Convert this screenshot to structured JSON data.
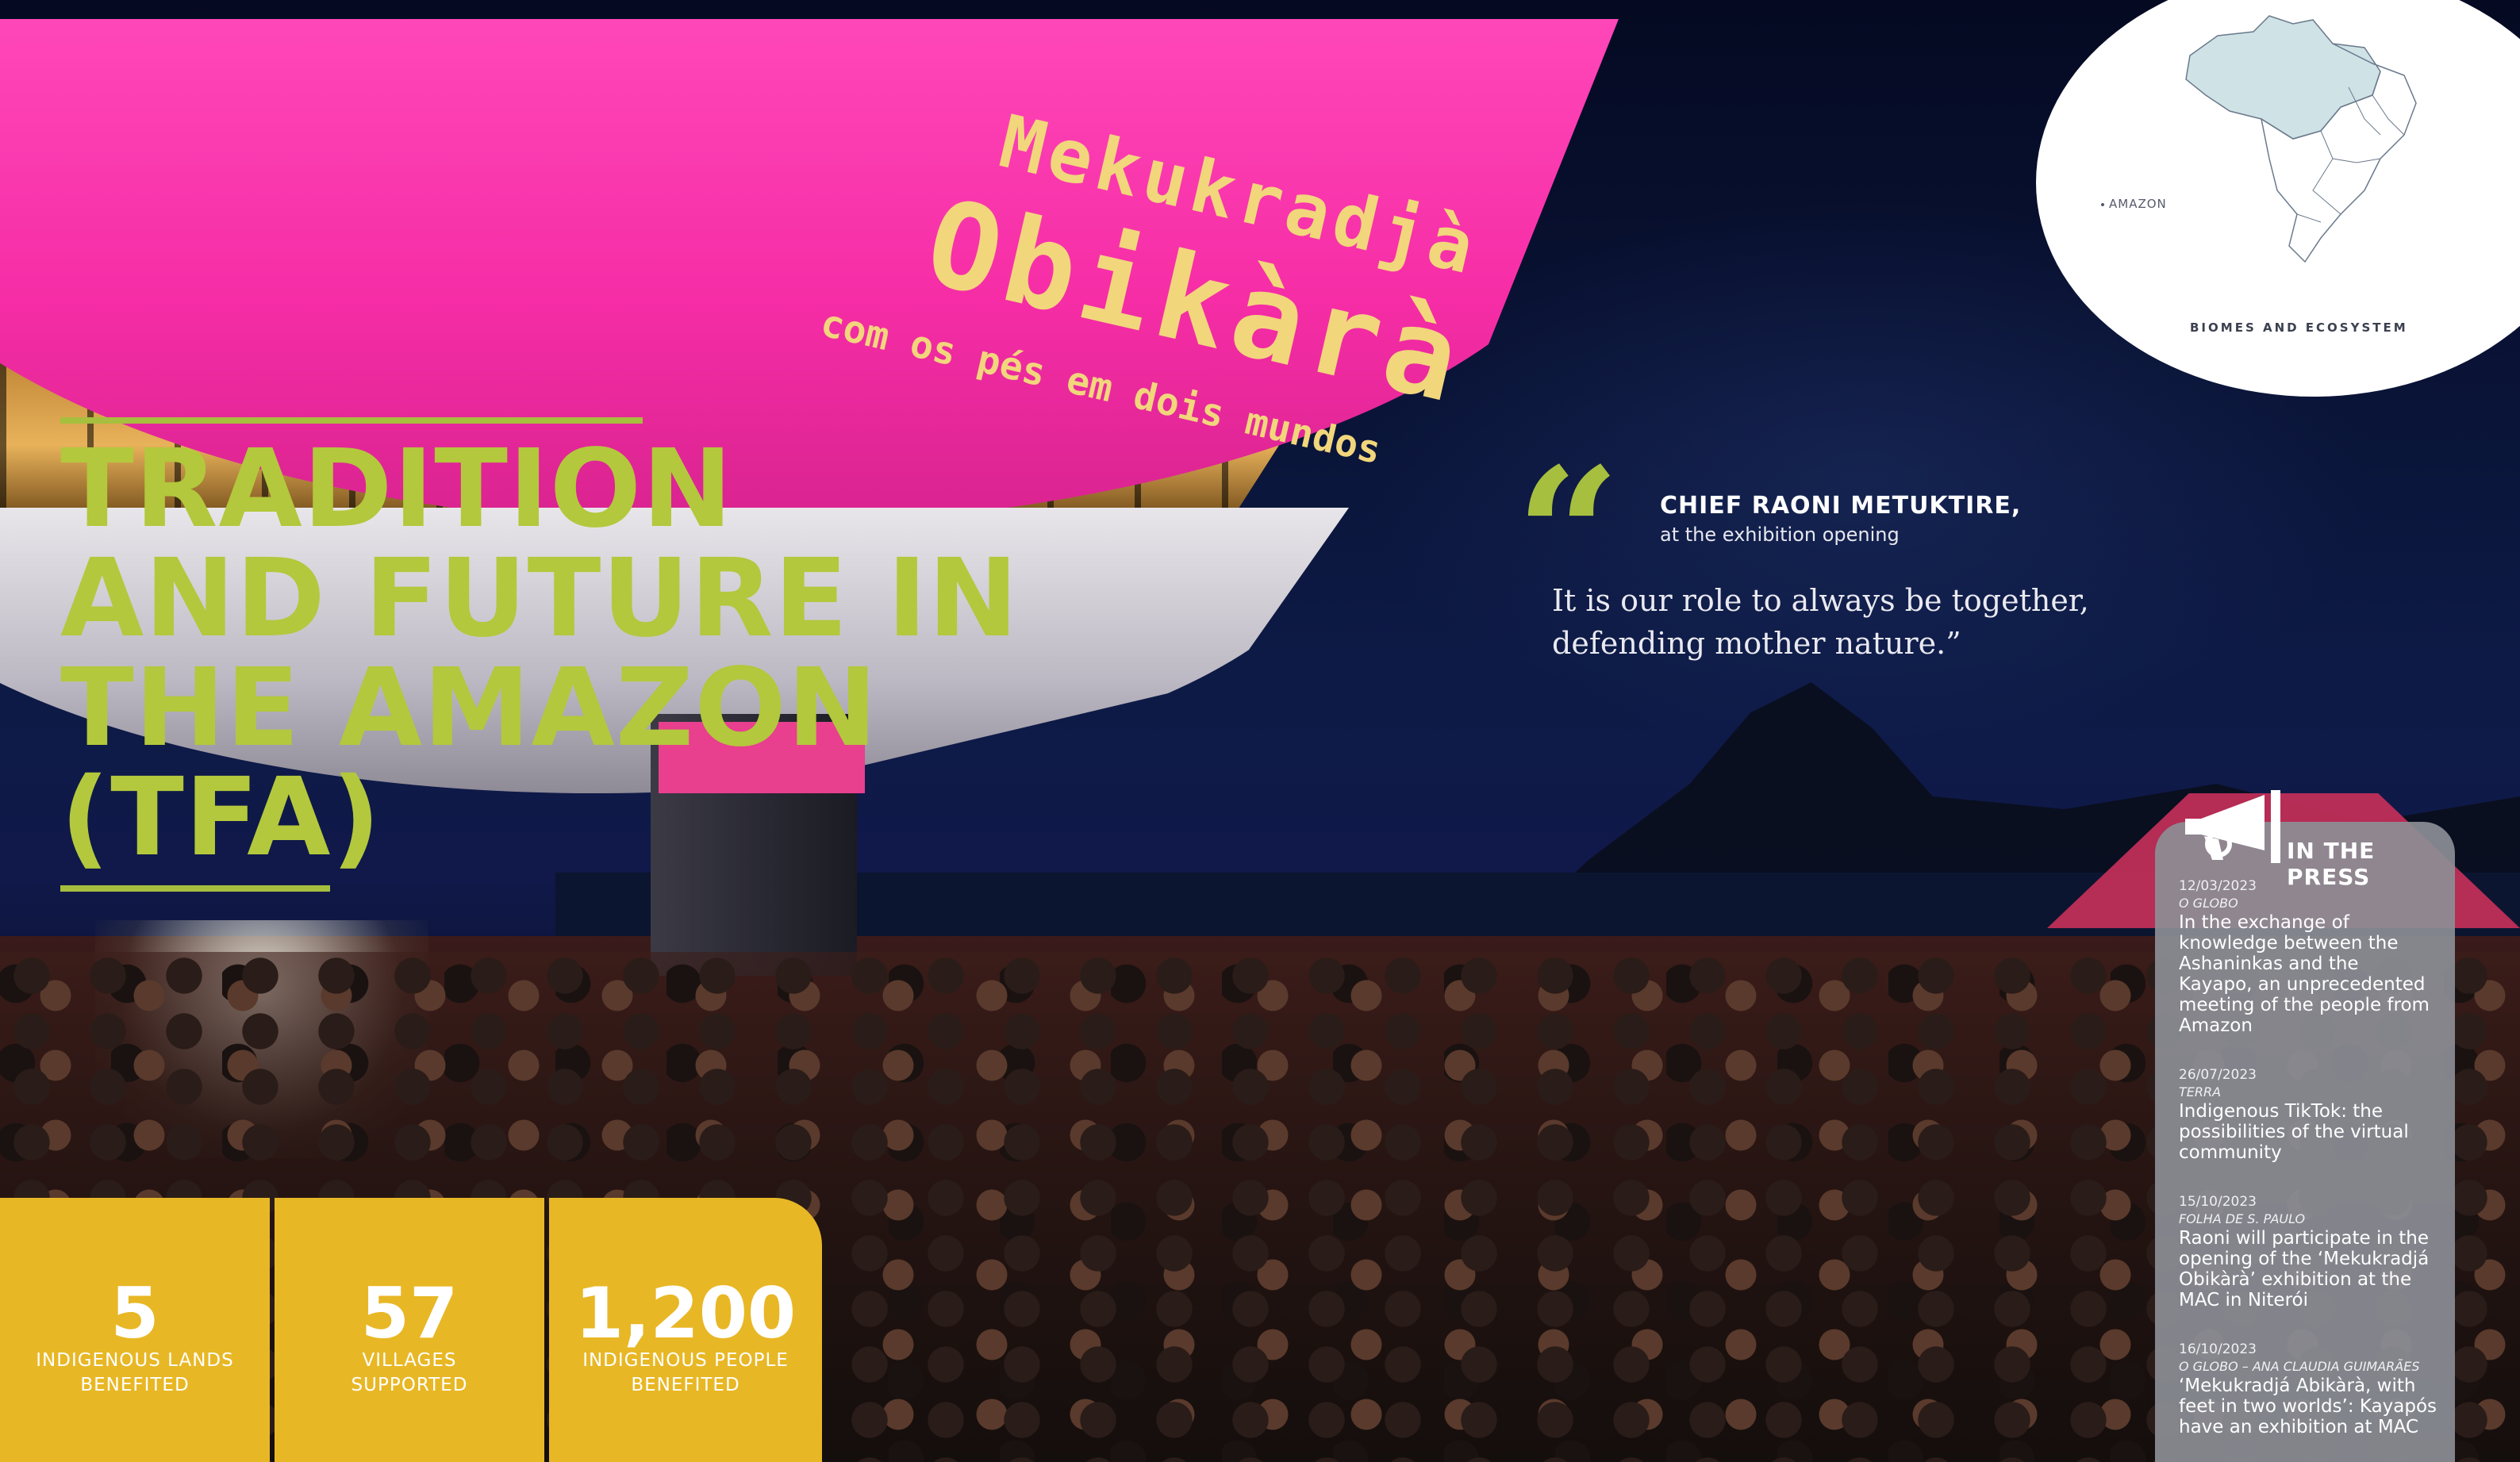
{
  "projection": {
    "line1": "Mekukradjà",
    "line2": "Obikàrà",
    "line3": "com os pés em dois mundos"
  },
  "title": {
    "lines": [
      "TRADITION",
      "AND FUTURE IN",
      "THE AMAZON",
      "(TFA)"
    ]
  },
  "quote": {
    "mark": "“",
    "author": "CHIEF RAONI METUKTIRE,",
    "context": "at the exhibition opening",
    "text": "It is our role to always be together, defending mother nature.”"
  },
  "map": {
    "legend_label": "AMAZON",
    "caption": "BIOMES AND ECOSYSTEM",
    "colors": {
      "amazon": "#cfe2e6",
      "outline": "#6b7a8c"
    }
  },
  "stats": [
    {
      "value": "5",
      "label_lines": [
        "INDIGENOUS LANDS",
        "BENEFITED"
      ]
    },
    {
      "value": "57",
      "label_lines": [
        "VILLAGES",
        "SUPPORTED"
      ]
    },
    {
      "value": "1,200",
      "label_lines": [
        "INDIGENOUS PEOPLE",
        "BENEFITED"
      ]
    }
  ],
  "press": {
    "title": "IN THE PRESS",
    "icon": "megaphone-icon",
    "items": [
      {
        "date": "12/03/2023",
        "source": "O GLOBO",
        "headline": "In the exchange of knowledge between the Ashaninkas and the Kayapo, an unprecedented meeting of the people from Amazon"
      },
      {
        "date": "26/07/2023",
        "source": "TERRA",
        "headline": "Indigenous TikTok: the possibilities of the virtual community"
      },
      {
        "date": "15/10/2023",
        "source": "FOLHA DE S. PAULO",
        "headline": "Raoni will participate in the opening of the ‘Mekukradjá Obikàrà’ exhibition at the MAC in Niterói"
      },
      {
        "date": "16/10/2023",
        "source": "O GLOBO – ANA CLAUDIA GUIMARÃES",
        "headline": "‘Mekukradjá Abikàrà, with feet in two worlds’: Kayapós have an exhibition at MAC"
      }
    ]
  },
  "colors": {
    "accent_green": "#a6bf3e",
    "stat_yellow": "#e8b725",
    "saucer_pink": "#f62da6",
    "press_grey": "#8c8e96"
  }
}
